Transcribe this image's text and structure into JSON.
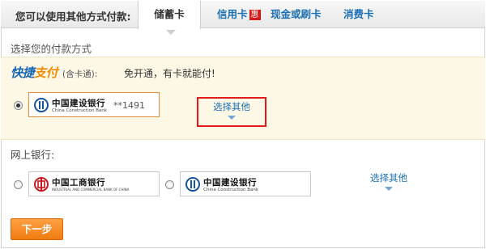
{
  "tabs": {
    "label": "您可以使用其他方式付款:",
    "items": [
      {
        "label": "储蓄卡",
        "active": true
      },
      {
        "label": "信用卡",
        "badge": "惠"
      },
      {
        "label": "现金或刷卡"
      },
      {
        "label": "消费卡"
      }
    ]
  },
  "section_title": "选择您的付款方式",
  "quick_pay": {
    "logo_part1": "快捷",
    "logo_part2": "支付",
    "sub": "(含卡通):",
    "promo": "免开通，有卡就能付!",
    "card": {
      "bank_cn": "中国建设银行",
      "bank_en": "China Construction Bank",
      "masked_number": "**1491",
      "selected": true
    },
    "choose_other": "选择其他"
  },
  "netbank": {
    "title": "网上银行:",
    "banks": [
      {
        "bank_cn": "中国工商银行",
        "bank_en": "INDUSTRIAL AND COMMERCIAL BANK OF CHINA"
      },
      {
        "bank_cn": "中国建设银行",
        "bank_en": "China Construction Bank"
      }
    ],
    "choose_other": "选择其他"
  },
  "next_button": "下一步",
  "colors": {
    "accent_blue": "#1a6fb4",
    "highlight_red": "#e31b1b",
    "button_orange": "#f38a1f",
    "panel_bg": "#fdf8e6"
  }
}
